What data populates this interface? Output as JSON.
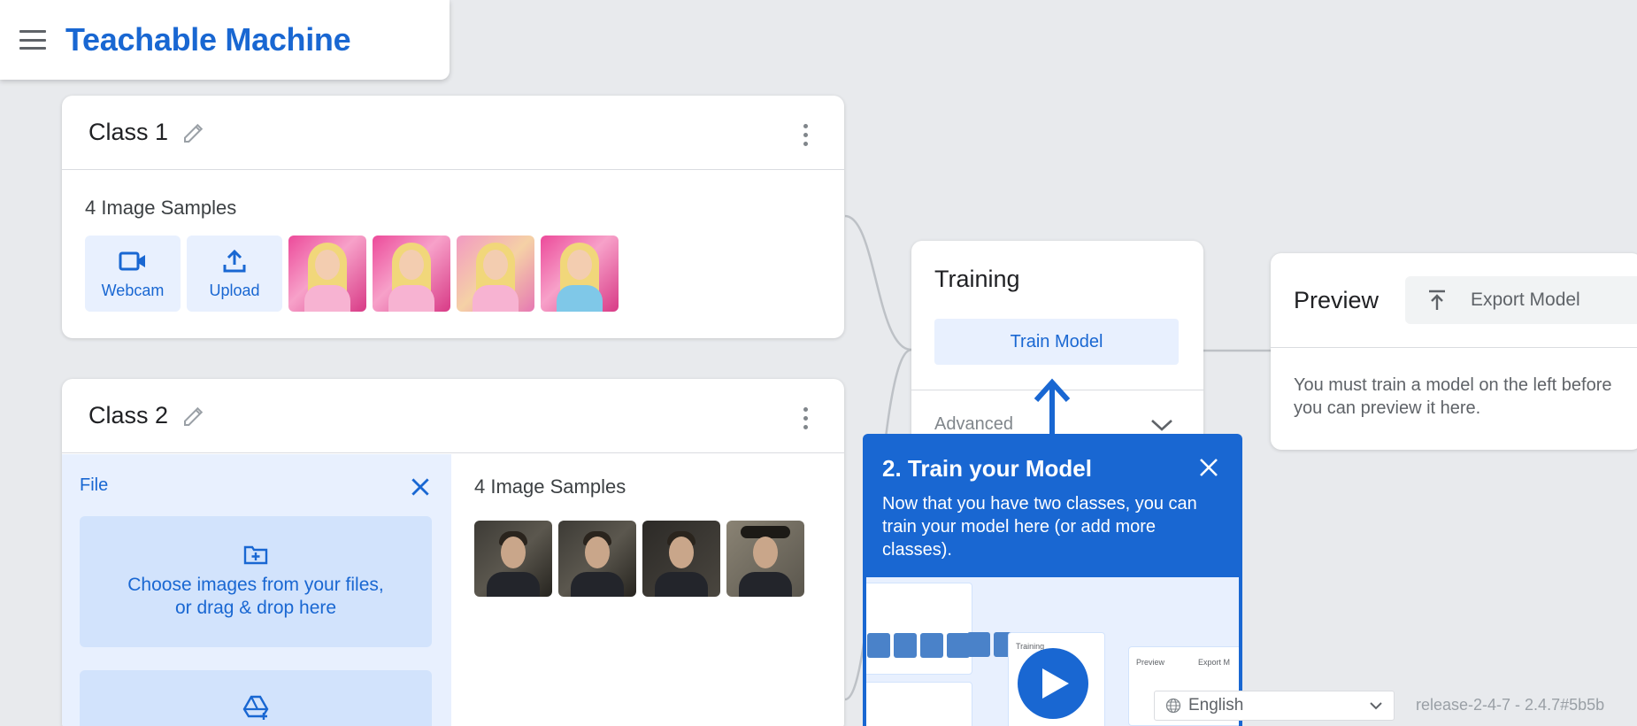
{
  "app": {
    "title": "Teachable Machine"
  },
  "classes": [
    {
      "name": "Class 1",
      "samples_label": "4 Image Samples",
      "buttons": {
        "webcam": "Webcam",
        "upload": "Upload"
      },
      "thumbnails": [
        "barbie-1",
        "barbie-2",
        "barbie-3",
        "barbie-4"
      ]
    },
    {
      "name": "Class 2",
      "file_panel": {
        "title": "File",
        "drop_text_line1": "Choose images from your files,",
        "drop_text_line2": "or drag & drop here"
      },
      "samples_label": "4 Image Samples",
      "thumbnails": [
        "oppenheimer-1",
        "oppenheimer-2",
        "oppenheimer-3",
        "oppenheimer-4"
      ]
    }
  ],
  "training": {
    "title": "Training",
    "train_button": "Train Model",
    "advanced_label": "Advanced"
  },
  "preview": {
    "title": "Preview",
    "export_button": "Export Model",
    "message": "You must train a model on the left before you can preview it here."
  },
  "tooltip": {
    "title": "2. Train your Model",
    "body": "Now that you have two classes, you can train your model here (or add more classes).",
    "video": {
      "training_label": "Training",
      "preview_label": "Preview",
      "export_label": "Export M"
    }
  },
  "footer": {
    "language": "English",
    "version": "release-2-4-7 - 2.4.7#5b5b"
  },
  "colors": {
    "brand": "#1967d2",
    "light_blue": "#e8f0fe",
    "background": "#e8eaed"
  },
  "icons": [
    "menu-icon",
    "edit-icon",
    "more-vert-icon",
    "webcam-icon",
    "upload-icon",
    "close-icon",
    "folder-add-icon",
    "drive-icon",
    "chevron-down-icon",
    "export-icon",
    "play-icon",
    "globe-icon"
  ]
}
